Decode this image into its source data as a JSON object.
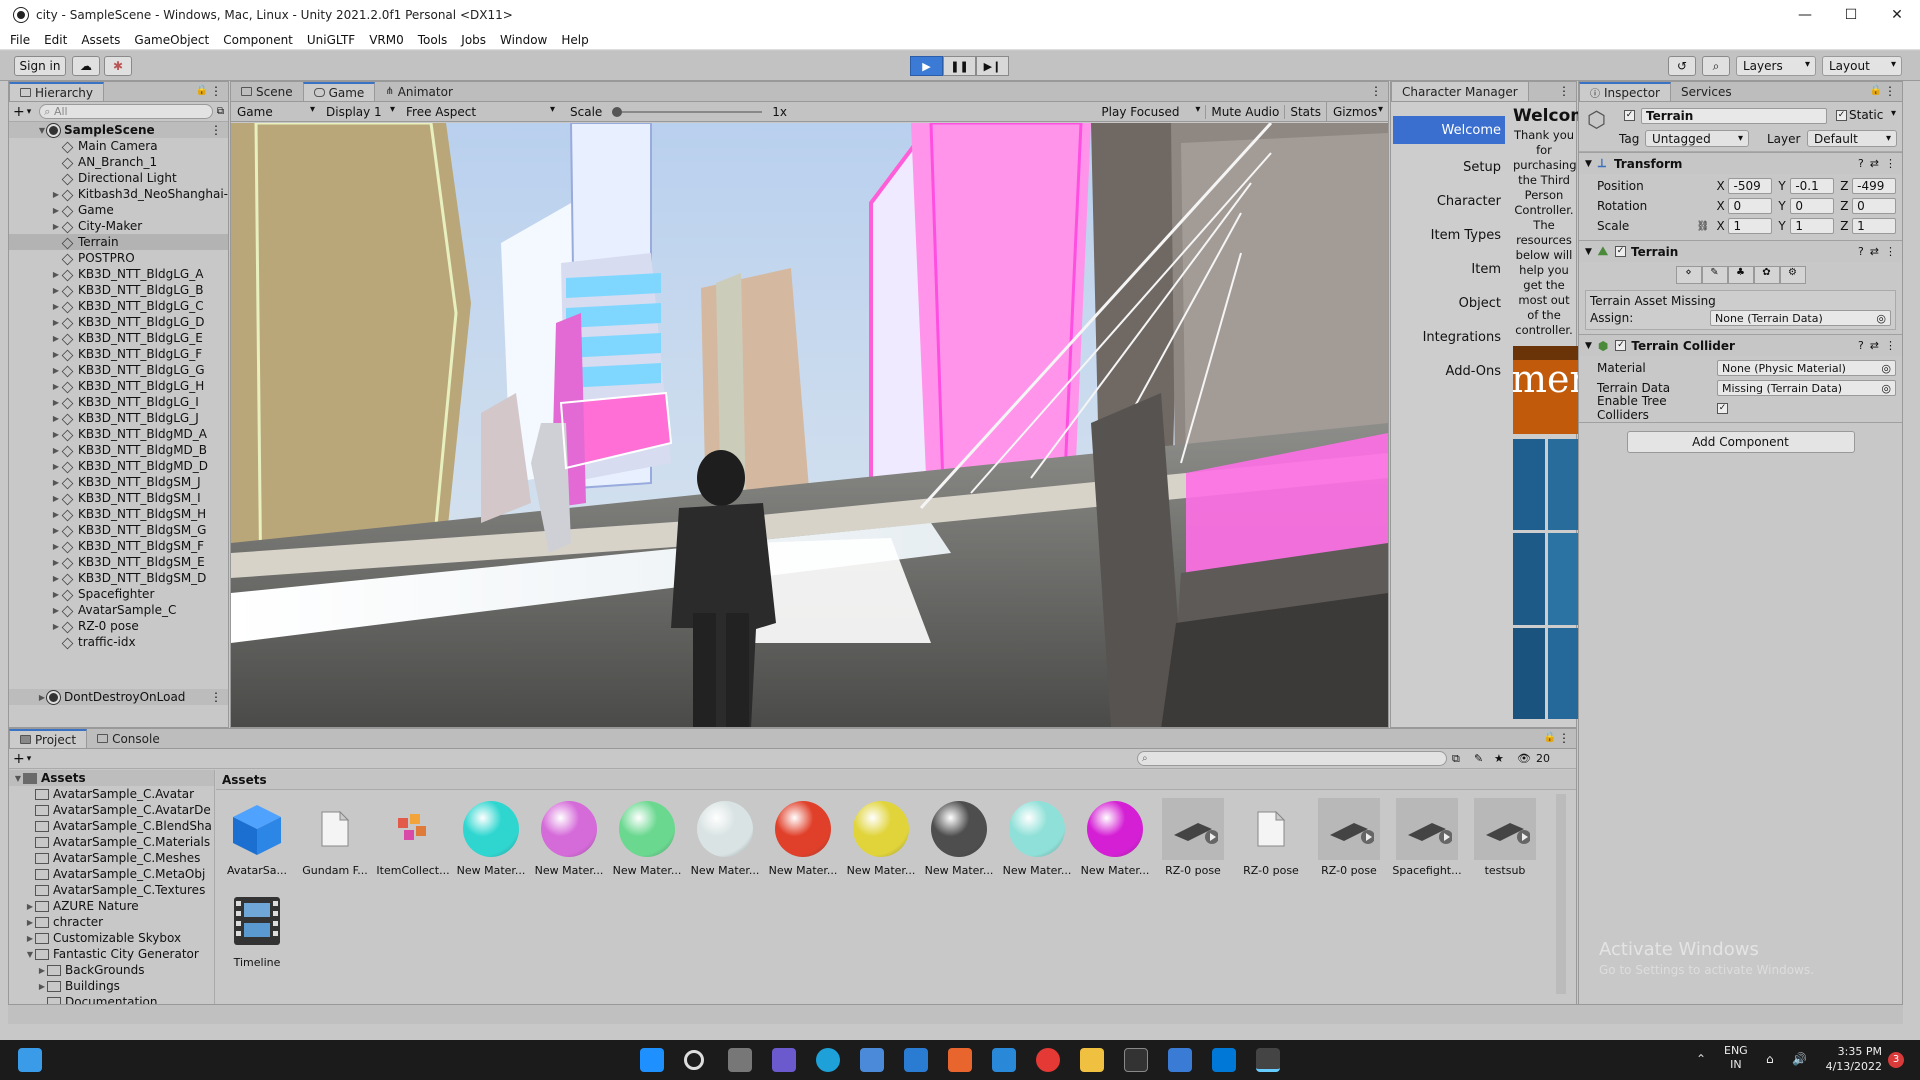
{
  "window": {
    "title": "city - SampleScene - Windows, Mac, Linux - Unity 2021.2.0f1 Personal <DX11>"
  },
  "menu": [
    "File",
    "Edit",
    "Assets",
    "GameObject",
    "Component",
    "UniGLTF",
    "VRM0",
    "Tools",
    "Jobs",
    "Window",
    "Help"
  ],
  "toolbar": {
    "signin": "Sign in",
    "layers": "Layers",
    "layout": "Layout"
  },
  "hierarchy": {
    "tab": "Hierarchy",
    "search_placeholder": "All",
    "scene": "SampleScene",
    "items": [
      "Main Camera",
      "AN_Branch_1",
      "Directional Light",
      "Kitbash3d_NeoShanghai-",
      "Game",
      "City-Maker",
      "Terrain",
      "POSTPRO",
      "KB3D_NTT_BldgLG_A",
      "KB3D_NTT_BldgLG_B",
      "KB3D_NTT_BldgLG_C",
      "KB3D_NTT_BldgLG_D",
      "KB3D_NTT_BldgLG_E",
      "KB3D_NTT_BldgLG_F",
      "KB3D_NTT_BldgLG_G",
      "KB3D_NTT_BldgLG_H",
      "KB3D_NTT_BldgLG_I",
      "KB3D_NTT_BldgLG_J",
      "KB3D_NTT_BldgMD_A",
      "KB3D_NTT_BldgMD_B",
      "KB3D_NTT_BldgMD_D",
      "KB3D_NTT_BldgSM_J",
      "KB3D_NTT_BldgSM_I",
      "KB3D_NTT_BldgSM_H",
      "KB3D_NTT_BldgSM_G",
      "KB3D_NTT_BldgSM_F",
      "KB3D_NTT_BldgSM_E",
      "KB3D_NTT_BldgSM_D",
      "Spacefighter",
      "AvatarSample_C",
      "RZ-0 pose",
      "traffic-idx"
    ],
    "dontdestroy": "DontDestroyOnLoad"
  },
  "gameview": {
    "tabs": [
      "Scene",
      "Game",
      "Animator"
    ],
    "mode": "Game",
    "display": "Display 1",
    "aspect": "Free Aspect",
    "scale_label": "Scale",
    "scale_value": "1x",
    "play_focused": "Play Focused",
    "mute": "Mute Audio",
    "stats": "Stats",
    "gizmos": "Gizmos"
  },
  "character_manager": {
    "tab": "Character Manager",
    "nav": [
      "Welcome",
      "Setup",
      "Character",
      "Item Types",
      "Item",
      "Object",
      "Integrations",
      "Add-Ons"
    ],
    "heading": "Welcom",
    "body": "Thank you for purchasing the Third Person Controller. The resources below will help you get the most out of the controller.",
    "banner_text": "men"
  },
  "inspector": {
    "tabs": [
      "Inspector",
      "Services"
    ],
    "object_name": "Terrain",
    "static_label": "Static",
    "tag_label": "Tag",
    "tag_value": "Untagged",
    "layer_label": "Layer",
    "layer_value": "Default",
    "transform": {
      "title": "Transform",
      "position": {
        "label": "Position",
        "x": "-509",
        "y": "-0.1",
        "z": "-499"
      },
      "rotation": {
        "label": "Rotation",
        "x": "0",
        "y": "0",
        "z": "0"
      },
      "scale": {
        "label": "Scale",
        "x": "1",
        "y": "1",
        "z": "1"
      }
    },
    "terrain": {
      "title": "Terrain",
      "missing": "Terrain Asset Missing",
      "assign_label": "Assign:",
      "assign_value": "None (Terrain Data)"
    },
    "collider": {
      "title": "Terrain Collider",
      "material_label": "Material",
      "material_value": "None (Physic Material)",
      "data_label": "Terrain Data",
      "data_value": "Missing (Terrain Data)",
      "trees_label": "Enable Tree Colliders"
    },
    "add_component": "Add Component",
    "watermark1": "Activate Windows",
    "watermark2": "Go to Settings to activate Windows."
  },
  "project": {
    "tabs": [
      "Project",
      "Console"
    ],
    "hidden_count": "20",
    "assets_root": "Assets",
    "breadcrumb": "Assets",
    "tree": [
      {
        "label": "AvatarSample_C.Avatar",
        "depth": 1,
        "fold": ""
      },
      {
        "label": "AvatarSample_C.AvatarDe",
        "depth": 1,
        "fold": ""
      },
      {
        "label": "AvatarSample_C.BlendSha",
        "depth": 1,
        "fold": ""
      },
      {
        "label": "AvatarSample_C.Materials",
        "depth": 1,
        "fold": ""
      },
      {
        "label": "AvatarSample_C.Meshes",
        "depth": 1,
        "fold": ""
      },
      {
        "label": "AvatarSample_C.MetaObj",
        "depth": 1,
        "fold": ""
      },
      {
        "label": "AvatarSample_C.Textures",
        "depth": 1,
        "fold": ""
      },
      {
        "label": "AZURE Nature",
        "depth": 1,
        "fold": "▶"
      },
      {
        "label": "chracter",
        "depth": 1,
        "fold": "▶"
      },
      {
        "label": "Customizable Skybox",
        "depth": 1,
        "fold": "▶"
      },
      {
        "label": "Fantastic City Generator",
        "depth": 1,
        "fold": "▼"
      },
      {
        "label": "BackGrounds",
        "depth": 2,
        "fold": "▶"
      },
      {
        "label": "Buildings",
        "depth": 2,
        "fold": "▶"
      },
      {
        "label": "Documentation",
        "depth": 2,
        "fold": ""
      }
    ],
    "assets": [
      {
        "label": "AvatarSa...",
        "kind": "cube"
      },
      {
        "label": "Gundam F...",
        "kind": "file"
      },
      {
        "label": "ItemCollect...",
        "kind": "blocks"
      },
      {
        "label": "New Mater...",
        "kind": "sphere",
        "color": "#2fd6d0"
      },
      {
        "label": "New Mater...",
        "kind": "sphere",
        "color": "#d56ad9"
      },
      {
        "label": "New Mater...",
        "kind": "sphere",
        "color": "#6ad88f"
      },
      {
        "label": "New Mater...",
        "kind": "sphere",
        "color": "#d9e3e3"
      },
      {
        "label": "New Mater...",
        "kind": "sphere",
        "color": "#e0402a"
      },
      {
        "label": "New Mater...",
        "kind": "sphere",
        "color": "#e0d43a"
      },
      {
        "label": "New Mater...",
        "kind": "sphere",
        "color": "#4e4e4e"
      },
      {
        "label": "New Mater...",
        "kind": "sphere",
        "color": "#8fe0d8"
      },
      {
        "label": "New Mater...",
        "kind": "sphere",
        "color": "#d41fd4"
      },
      {
        "label": "RZ-0 pose",
        "kind": "model"
      },
      {
        "label": "RZ-0 pose",
        "kind": "file"
      },
      {
        "label": "RZ-0 pose",
        "kind": "model"
      },
      {
        "label": "Spacefight...",
        "kind": "model"
      },
      {
        "label": "testsub",
        "kind": "model"
      },
      {
        "label": "Timeline",
        "kind": "timeline"
      }
    ]
  },
  "taskbar": {
    "lang1": "ENG",
    "lang2": "IN",
    "time": "3:35 PM",
    "date": "4/13/2022",
    "badge": "3"
  }
}
